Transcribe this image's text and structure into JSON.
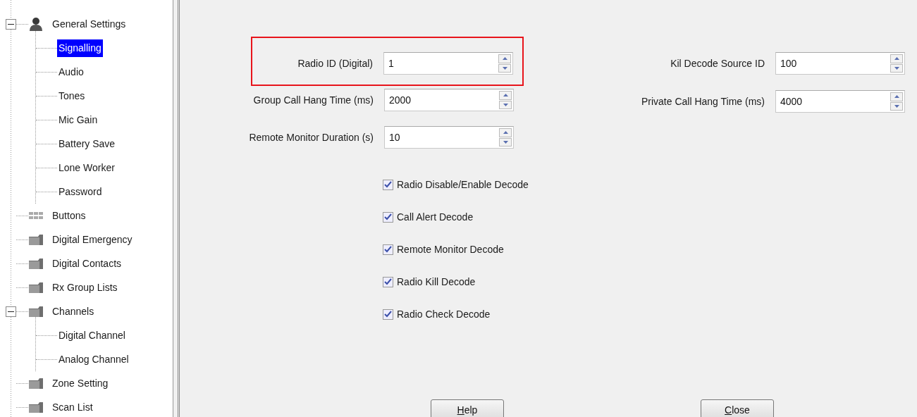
{
  "tree": [
    {
      "label": "General Settings",
      "kind": "person",
      "expanded": true,
      "selected": false,
      "children": [
        {
          "label": "Signalling",
          "selected": true
        },
        {
          "label": "Audio",
          "selected": false
        },
        {
          "label": "Tones",
          "selected": false
        },
        {
          "label": "Mic Gain",
          "selected": false
        },
        {
          "label": "Battery Save",
          "selected": false
        },
        {
          "label": "Lone Worker",
          "selected": false
        },
        {
          "label": "Password",
          "selected": false
        }
      ]
    },
    {
      "label": "Buttons",
      "kind": "grid",
      "selected": false
    },
    {
      "label": "Digital Emergency",
      "kind": "folder",
      "selected": false
    },
    {
      "label": "Digital Contacts",
      "kind": "folder",
      "selected": false
    },
    {
      "label": "Rx Group Lists",
      "kind": "folder",
      "selected": false
    },
    {
      "label": "Channels",
      "kind": "folder",
      "expanded": true,
      "selected": false,
      "children": [
        {
          "label": "Digital Channel",
          "selected": false
        },
        {
          "label": "Analog Channel",
          "selected": false
        }
      ]
    },
    {
      "label": "Zone Setting",
      "kind": "folder",
      "selected": false
    },
    {
      "label": "Scan List",
      "kind": "folder",
      "selected": false
    }
  ],
  "fields_left": [
    {
      "label": "Radio ID (Digital)",
      "value": "1",
      "highlighted": true
    },
    {
      "label": "Group Call Hang Time (ms)",
      "value": "2000",
      "highlighted": false
    },
    {
      "label": "Remote Monitor Duration (s)",
      "value": "10",
      "highlighted": false
    }
  ],
  "fields_right": [
    {
      "label": "Kil Decode Source ID",
      "value": "100"
    },
    {
      "label": "Private Call Hang Time (ms)",
      "value": "4000"
    }
  ],
  "checkboxes": [
    {
      "label": "Radio Disable/Enable Decode",
      "checked": true
    },
    {
      "label": "Call Alert Decode",
      "checked": true
    },
    {
      "label": "Remote Monitor Decode",
      "checked": true
    },
    {
      "label": "Radio Kill Decode",
      "checked": true
    },
    {
      "label": "Radio Check Decode",
      "checked": true
    }
  ],
  "buttons": [
    {
      "label": "Help"
    },
    {
      "label": "Close"
    }
  ]
}
